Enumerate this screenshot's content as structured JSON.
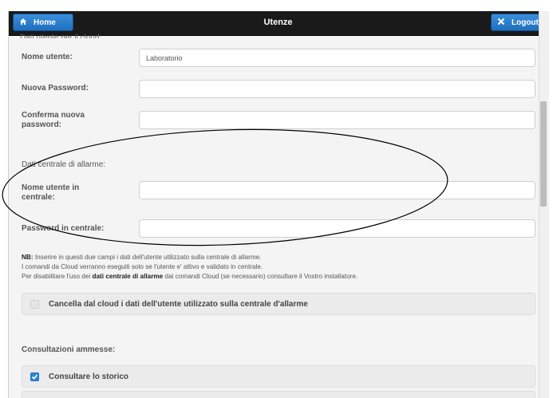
{
  "header": {
    "title": "Utenze",
    "home_label": "Home",
    "logout_label": "Logout",
    "home_icon": "home-icon",
    "logout_icon": "close-icon"
  },
  "form": {
    "clipped_heading": "Dati utente per il cloud:",
    "username_label": "Nome utente:",
    "username_value": "Laboratorio",
    "new_password_label": "Nuova Password:",
    "confirm_password_label_line1": "Conferma nuova",
    "confirm_password_label_line2": "password:",
    "alarm_section_label": "Dati centrale di allarme:",
    "central_username_label_line1": "Nome utente in",
    "central_username_label_line2": "centrale:",
    "central_password_label": "Password in centrale:"
  },
  "note": {
    "prefix": "NB:",
    "line1": " Inserire in questi due campi i dati dell'utente utilizzato sulla centrale di allarme.",
    "line2": "I comandi da Cloud verranno eseguiti solo se l'utente e' attivo e validato in centrale.",
    "line3_a": "Per disabilitare l'uso dei ",
    "line3_bold": "dati centrale di allarme",
    "line3_b": " dai comandi Cloud (se necessario) consultare il Vostro installatore."
  },
  "checkbox_delete": {
    "label": "Cancella dal cloud i dati dell'utente utilizzato sulla centrale d'allarme",
    "checked": false
  },
  "consultations": {
    "title": "Consultazioni ammesse:",
    "items": [
      {
        "label": "Consultare lo storico",
        "checked": true
      }
    ]
  },
  "colors": {
    "accent": "#2f86d4",
    "topbar": "#1a1a1a"
  }
}
